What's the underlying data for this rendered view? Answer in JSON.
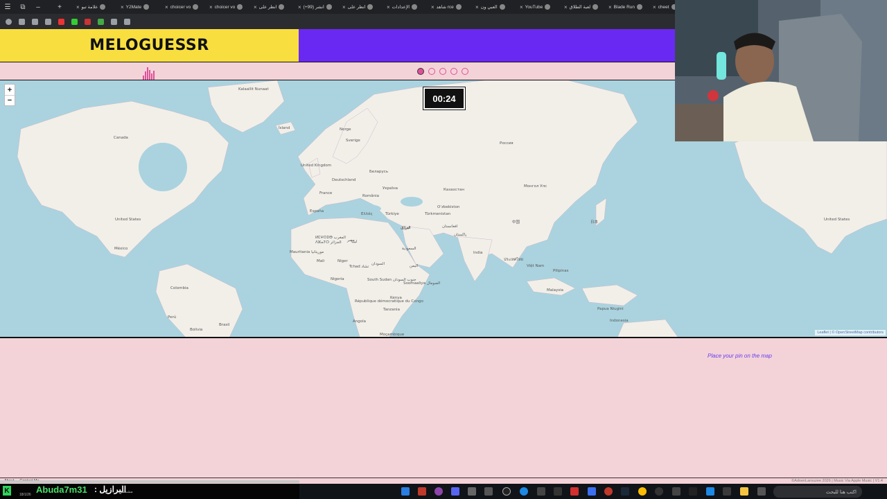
{
  "browser": {
    "tabs": [
      {
        "title": "علامة تبو"
      },
      {
        "title": "Y2Mate"
      },
      {
        "title": "choicer vo"
      },
      {
        "title": "choicer vo"
      },
      {
        "title": "انظر على"
      },
      {
        "title": "(+99) انشر"
      },
      {
        "title": "انظر على"
      },
      {
        "title": "الإعدادات"
      },
      {
        "title": "شاهد rce"
      },
      {
        "title": "العبي ون"
      },
      {
        "title": "YouTube"
      },
      {
        "title": "لعبة الطلاق"
      },
      {
        "title": "Blade Run"
      },
      {
        "title": "cheet"
      }
    ]
  },
  "header": {
    "logo": "MELOGUESSR"
  },
  "round_dots": {
    "total": 5,
    "current": 1
  },
  "timer": {
    "text": "00:24"
  },
  "map": {
    "zoom_in": "+",
    "zoom_out": "−",
    "attribution": "Leaflet | © OpenStreetMap contributors",
    "labels": [
      {
        "text": "Kalaallit Nunaat"
      },
      {
        "text": "Ísland"
      },
      {
        "text": "Canada"
      },
      {
        "text": "Norge"
      },
      {
        "text": "Sverige"
      },
      {
        "text": "Россия"
      },
      {
        "text": "United Kingdom"
      },
      {
        "text": "Deutschland"
      },
      {
        "text": "Беларусь"
      },
      {
        "text": "France"
      },
      {
        "text": "Україна"
      },
      {
        "text": "România"
      },
      {
        "text": "Казахстан"
      },
      {
        "text": "Монгол Улс"
      },
      {
        "text": "España"
      },
      {
        "text": "Türkiye"
      },
      {
        "text": "Oʻzbekiston"
      },
      {
        "text": "Türkmenistan"
      },
      {
        "text": "United States"
      },
      {
        "text": "United States"
      },
      {
        "text": "ایران"
      },
      {
        "text": "افغانستان"
      },
      {
        "text": "پاکستان"
      },
      {
        "text": "中国"
      },
      {
        "text": "日本"
      },
      {
        "text": "México"
      },
      {
        "text": "Mauritania موريتانيا"
      },
      {
        "text": "Mali"
      },
      {
        "text": "Niger"
      },
      {
        "text": "Tchad تشاد"
      },
      {
        "text": "السعودية"
      },
      {
        "text": "اليمن"
      },
      {
        "text": "India"
      },
      {
        "text": "ประเทศไทย"
      },
      {
        "text": "Việt Nam"
      },
      {
        "text": "Pilipinas"
      },
      {
        "text": "Nigeria"
      },
      {
        "text": "South Sudan جنوب السودان"
      },
      {
        "text": "Soomaaliya الصومال"
      },
      {
        "text": "Colombia"
      },
      {
        "text": "Malaysia"
      },
      {
        "text": "Kenya"
      },
      {
        "text": "République démocratique du Congo"
      },
      {
        "text": "Tanzania"
      },
      {
        "text": "Papua Niugini"
      },
      {
        "text": "Indonesia"
      },
      {
        "text": "Perú"
      },
      {
        "text": "Angola"
      },
      {
        "text": "Brasil"
      },
      {
        "text": "Bolivia"
      },
      {
        "text": "Moçambique"
      },
      {
        "text": "ⵍⵎⵖⵔⵉⴱ المغرب"
      },
      {
        "text": "ⴷⵣⴰⵢⵔ الجزائر"
      },
      {
        "text": "ليبيا"
      },
      {
        "text": "مصر"
      },
      {
        "text": "السودان"
      },
      {
        "text": "العراق"
      },
      {
        "text": "Ελλάς"
      }
    ]
  },
  "instruction": "Place your pin on the map",
  "footer": {
    "about": "About",
    "contact": "Contact Me",
    "credit": "©AdnenLarouzee 2026 | Music Via Apple Music | V1.4"
  },
  "stream_overlay": {
    "name": "Abuda7m31",
    "message": ": البرازيل",
    "sub": "مشمس",
    "date": "18/1/26"
  },
  "taskbar": {
    "search_placeholder": "اكتب هنا للبحث"
  },
  "colors": {
    "yellow": "#f8df3f",
    "purple": "#6a29f2",
    "pink_bg": "#f3d3d8",
    "accent_pink": "#e0509a",
    "water": "#aad3df",
    "land": "#f2efe9"
  }
}
